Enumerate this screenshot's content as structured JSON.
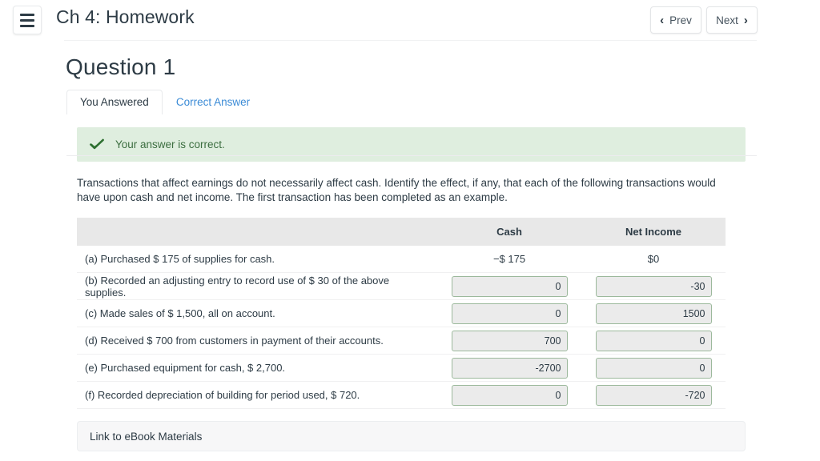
{
  "topbar": {
    "menu_icon": "hamburger-icon",
    "course_title": "Ch 4: Homework",
    "prev_label": "Prev",
    "next_label": "Next",
    "prev_chevron": "‹",
    "next_chevron": "›"
  },
  "page": {
    "question_title": "Question 1"
  },
  "tabs": [
    {
      "label": "You Answered",
      "active": true
    },
    {
      "label": "Correct Answer",
      "active": false
    }
  ],
  "alert": {
    "icon": "check-icon",
    "text": "Your answer is correct.",
    "background": "#dfeedf",
    "text_color": "#3c6e40",
    "icon_color": "#2e7031"
  },
  "question": {
    "prompt": "Transactions that affect earnings do not necessarily affect cash. Identify the effect, if any, that each of the following transactions would have upon cash and net income. The first transaction has been completed as an example."
  },
  "table": {
    "headers": {
      "description": "",
      "cash": "Cash",
      "net_income": "Net Income"
    },
    "rows": [
      {
        "description": "(a) Purchased $ 175 of supplies for cash.",
        "type": "text",
        "cash": "−$ 175",
        "net_income": "$0"
      },
      {
        "description": "(b) Recorded an adjusting entry to record use of $ 30 of the above supplies.",
        "type": "input",
        "cash": "0",
        "net_income": "-30"
      },
      {
        "description": "(c) Made sales of $ 1,500, all on account.",
        "type": "input",
        "cash": "0",
        "net_income": "1500"
      },
      {
        "description": "(d) Received $ 700 from customers in payment of their accounts.",
        "type": "input",
        "cash": "700",
        "net_income": "0"
      },
      {
        "description": "(e) Purchased equipment for cash, $ 2,700.",
        "type": "input",
        "cash": "-2700",
        "net_income": "0"
      },
      {
        "description": "(f) Recorded depreciation of building for period used, $ 720.",
        "type": "input",
        "cash": "0",
        "net_income": "-720"
      }
    ]
  },
  "ebook": {
    "label": "Link to eBook Materials"
  },
  "colors": {
    "accent_link": "#3b8bd6",
    "text": "#2d3b45",
    "input_border_correct": "#9cb99c",
    "input_fill": "#ebebeb",
    "table_header_bg": "#e8e8e8"
  }
}
